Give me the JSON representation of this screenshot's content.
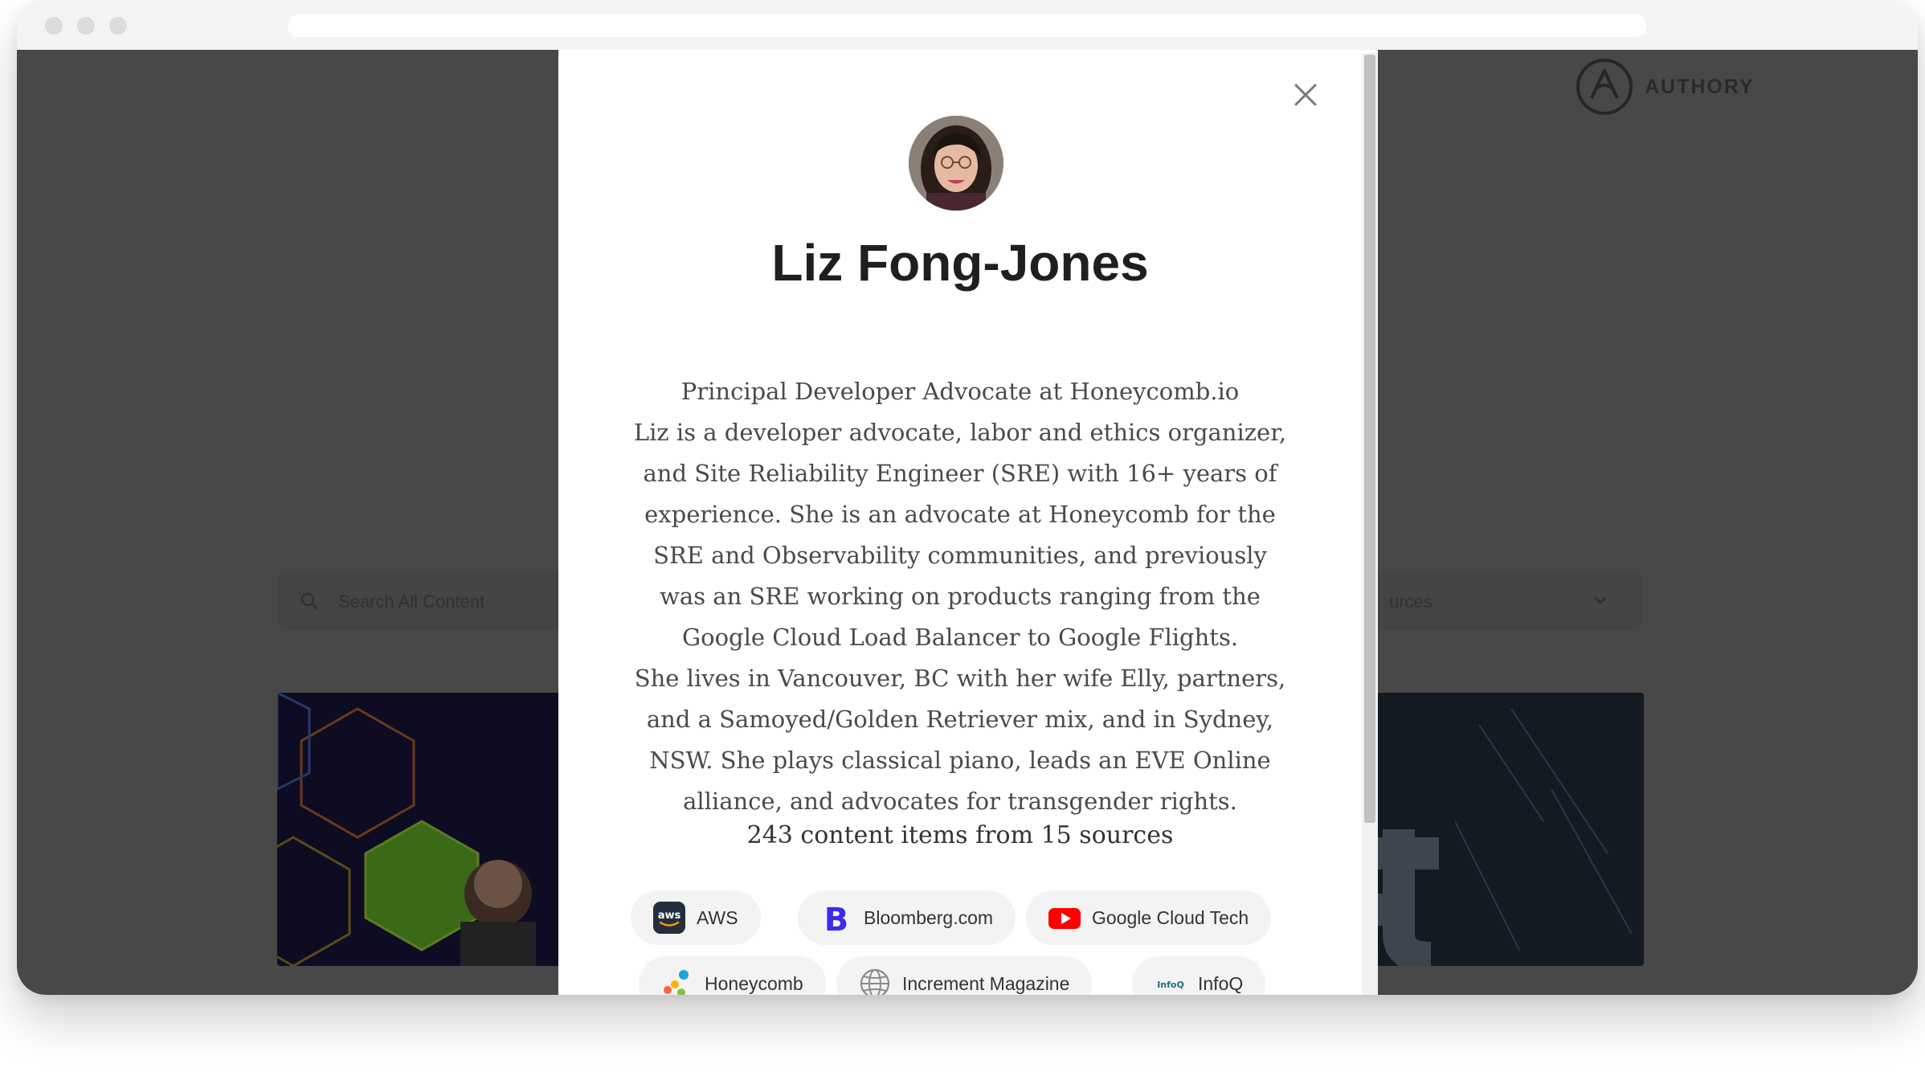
{
  "background": {
    "logo_text": "AUTHORY",
    "search_placeholder": "Search All Content",
    "sources_filter": "urces"
  },
  "modal": {
    "name": "Liz Fong-Jones",
    "bio": [
      "Principal Developer Advocate at Honeycomb.io",
      "Liz is a developer advocate, labor and ethics organizer, and Site Reliability Engineer (SRE) with 16+ years of experience. She is an advocate at Honeycomb for the SRE and Observability communities, and previously was an SRE working on products ranging from the Google Cloud Load Balancer to Google Flights.",
      "She lives in Vancouver, BC with her wife Elly, partners, and a Samoyed/Golden Retriever mix, and in Sydney, NSW. She plays classical piano, leads an EVE Online alliance, and advocates for transgender rights."
    ],
    "content_summary": "243 content items from 15 sources",
    "sources": [
      {
        "label": "AWS",
        "icon": "aws-icon",
        "icon_text": "aws"
      },
      {
        "label": "Bloomberg.com",
        "icon": "bloomberg-icon",
        "icon_text": "B"
      },
      {
        "label": "Google Cloud Tech",
        "icon": "youtube-icon"
      },
      {
        "label": "Honeycomb",
        "icon": "honeycomb-icon"
      },
      {
        "label": "Increment Magazine",
        "icon": "globe-icon"
      },
      {
        "label": "InfoQ",
        "icon": "infoq-icon",
        "icon_text": "InfoQ"
      }
    ]
  },
  "colors": {
    "overlay": "#484848",
    "modal_bg": "#ffffff",
    "chip_bg": "#f3f3f3",
    "bloomberg": "#3b2cf0",
    "youtube": "#ff0000",
    "aws_bg": "#232f3e",
    "aws_smile": "#ff9900"
  }
}
